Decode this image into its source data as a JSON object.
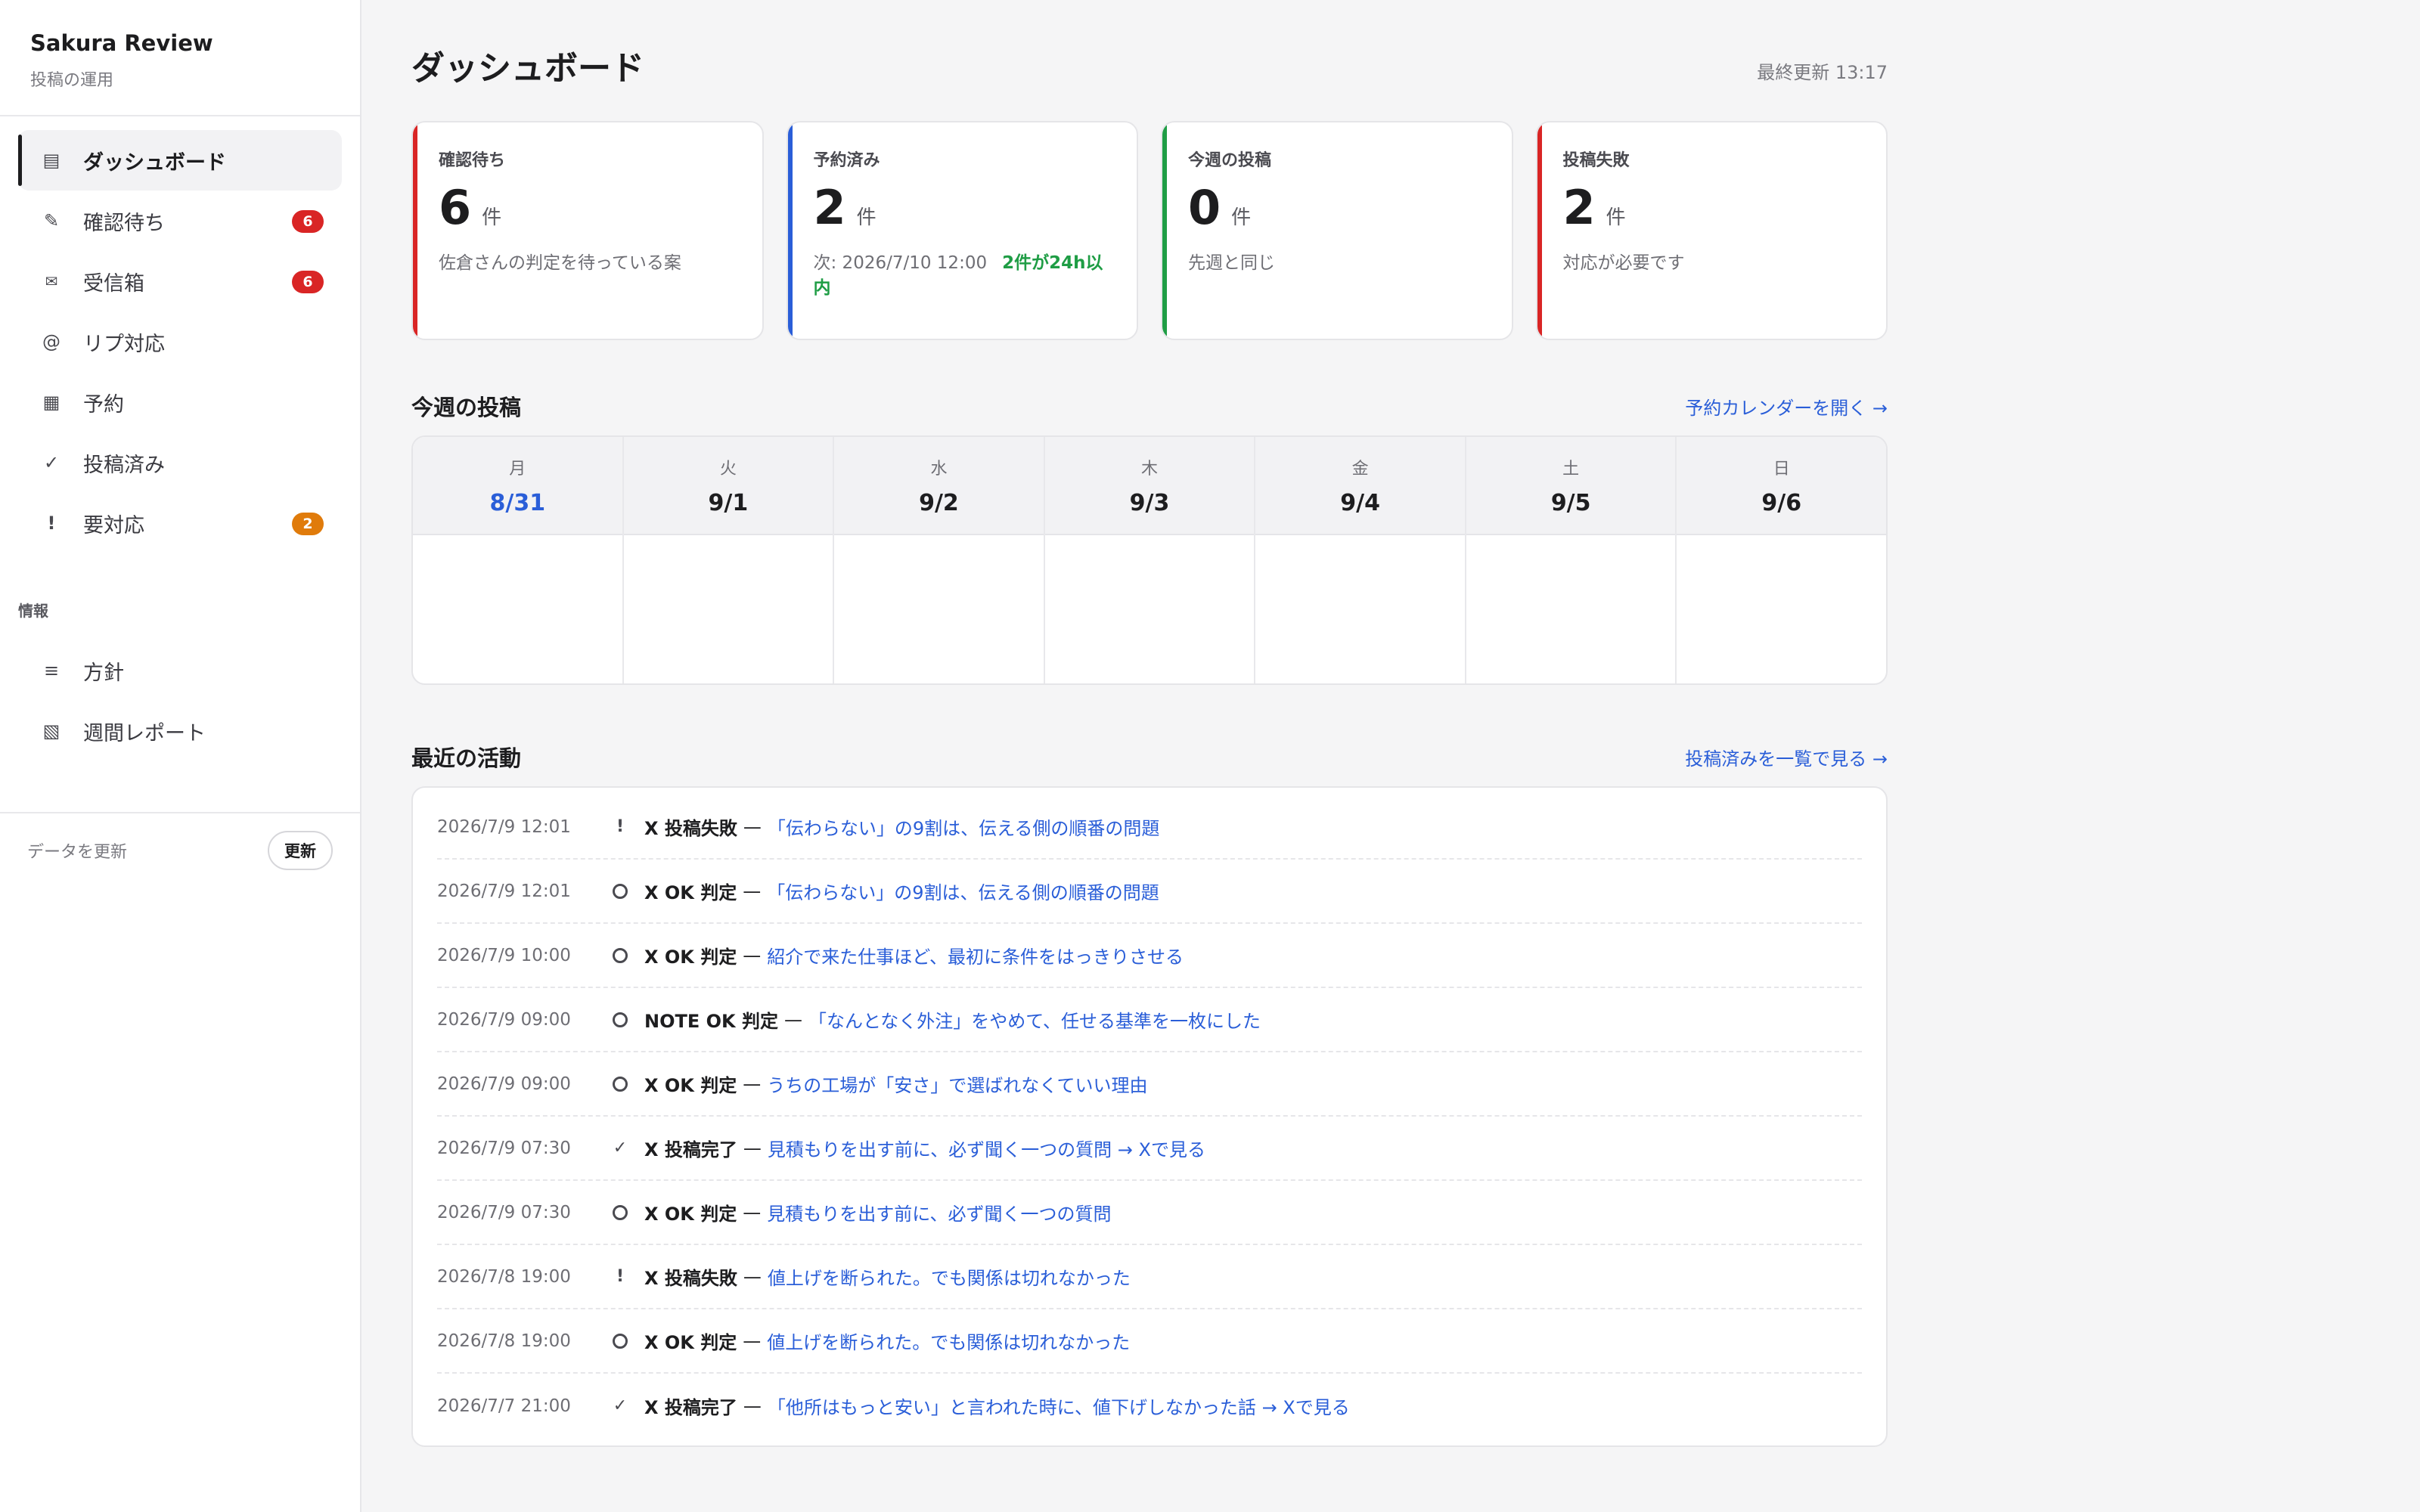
{
  "brand": {
    "title": "Sakura Review",
    "subtitle": "投稿の運用"
  },
  "nav": [
    {
      "icon": "▤",
      "label": "ダッシュボード",
      "active": true,
      "badge": ""
    },
    {
      "icon": "✎",
      "label": "確認待ち",
      "active": false,
      "badge": "6"
    },
    {
      "icon": "✉",
      "label": "受信箱",
      "active": false,
      "badge": "6"
    },
    {
      "icon": "@",
      "label": "リプ対応",
      "active": false,
      "badge": ""
    },
    {
      "icon": "▦",
      "label": "予約",
      "active": false,
      "badge": ""
    },
    {
      "icon": "✓",
      "label": "投稿済み",
      "active": false,
      "badge": ""
    },
    {
      "icon": "!",
      "label": "要対応",
      "active": false,
      "badge": "2"
    }
  ],
  "info_section": {
    "label": "情報",
    "items": [
      {
        "icon": "≡",
        "label": "方針"
      },
      {
        "icon": "▧",
        "label": "週間レポート"
      }
    ]
  },
  "sidebar_footer": {
    "label": "データを更新",
    "button": "更新"
  },
  "header": {
    "title": "ダッシュボード",
    "last_updated": "最終更新 13:17"
  },
  "cards": [
    {
      "label": "確認待ち",
      "value": "6",
      "unit": "件",
      "sub": "佐倉さんの判定を待っている案",
      "sub_highlight": "",
      "accent": "#d92525"
    },
    {
      "label": "予約済み",
      "value": "2",
      "unit": "件",
      "sub": "次: 2026/7/10 12:00",
      "sub_highlight": "2件が24h以内",
      "accent": "#2a5ed8"
    },
    {
      "label": "今週の投稿",
      "value": "0",
      "unit": "件",
      "sub": "先週と同じ",
      "sub_highlight": "",
      "accent": "#1f9d45"
    },
    {
      "label": "投稿失敗",
      "value": "2",
      "unit": "件",
      "sub": "対応が必要です",
      "sub_highlight": "",
      "accent": "#d92525"
    }
  ],
  "week": {
    "title": "今週の投稿",
    "link": "予約カレンダーを開く →",
    "days": [
      {
        "name": "月",
        "date": "8/31",
        "today": true
      },
      {
        "name": "火",
        "date": "9/1",
        "today": false
      },
      {
        "name": "水",
        "date": "9/2",
        "today": false
      },
      {
        "name": "木",
        "date": "9/3",
        "today": false
      },
      {
        "name": "金",
        "date": "9/4",
        "today": false
      },
      {
        "name": "土",
        "date": "9/5",
        "today": false
      },
      {
        "name": "日",
        "date": "9/6",
        "today": false
      }
    ]
  },
  "activity": {
    "title": "最近の活動",
    "link": "投稿済みを一覧で見る →",
    "rows": [
      {
        "time": "2026/7/9 12:01",
        "icon": "alert",
        "label": "X 投稿失敗",
        "text": "「伝わらない」の9割は、伝える側の順番の問題"
      },
      {
        "time": "2026/7/9 12:01",
        "icon": "circle",
        "label": "X OK 判定",
        "text": "「伝わらない」の9割は、伝える側の順番の問題"
      },
      {
        "time": "2026/7/9 10:00",
        "icon": "circle",
        "label": "X OK 判定",
        "text": "紹介で来た仕事ほど、最初に条件をはっきりさせる"
      },
      {
        "time": "2026/7/9 09:00",
        "icon": "circle",
        "label": "NOTE OK 判定",
        "text": "「なんとなく外注」をやめて、任せる基準を一枚にした"
      },
      {
        "time": "2026/7/9 09:00",
        "icon": "circle",
        "label": "X OK 判定",
        "text": "うちの工場が「安さ」で選ばれなくていい理由"
      },
      {
        "time": "2026/7/9 07:30",
        "icon": "check",
        "label": "X 投稿完了",
        "text": "見積もりを出す前に、必ず聞く一つの質問 → Xで見る"
      },
      {
        "time": "2026/7/9 07:30",
        "icon": "circle",
        "label": "X OK 判定",
        "text": "見積もりを出す前に、必ず聞く一つの質問"
      },
      {
        "time": "2026/7/8 19:00",
        "icon": "alert",
        "label": "X 投稿失敗",
        "text": "値上げを断られた。でも関係は切れなかった"
      },
      {
        "time": "2026/7/8 19:00",
        "icon": "circle",
        "label": "X OK 判定",
        "text": "値上げを断られた。でも関係は切れなかった"
      },
      {
        "time": "2026/7/7 21:00",
        "icon": "check",
        "label": "X 投稿完了",
        "text": "「他所はもっと安い」と言われた時に、値下げしなかった話 → Xで見る"
      }
    ]
  }
}
